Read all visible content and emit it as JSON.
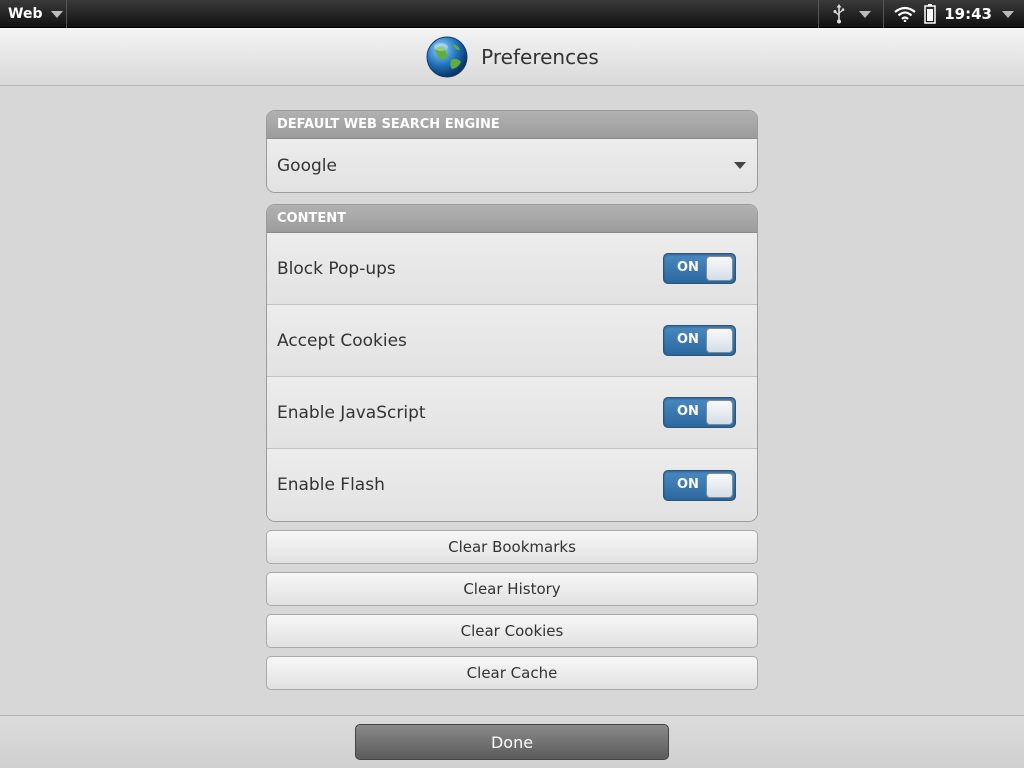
{
  "status_bar": {
    "app_name": "Web",
    "time": "19:43",
    "icons": [
      "chevron-down-icon",
      "usb-icon",
      "wifi-icon",
      "battery-icon"
    ]
  },
  "header": {
    "title": "Preferences",
    "icon": "globe-icon"
  },
  "search_engine": {
    "section_title": "DEFAULT WEB SEARCH ENGINE",
    "selected": "Google"
  },
  "content": {
    "section_title": "CONTENT",
    "settings": [
      {
        "label": "Block Pop-ups",
        "state": "ON"
      },
      {
        "label": "Accept Cookies",
        "state": "ON"
      },
      {
        "label": "Enable JavaScript",
        "state": "ON"
      },
      {
        "label": "Enable Flash",
        "state": "ON"
      }
    ]
  },
  "actions": {
    "clear_bookmarks": "Clear Bookmarks",
    "clear_history": "Clear History",
    "clear_cookies": "Clear Cookies",
    "clear_cache": "Clear Cache"
  },
  "footer": {
    "done_label": "Done"
  },
  "colors": {
    "toggle_on": "#2f70a8",
    "background": "#d7d7d7"
  }
}
